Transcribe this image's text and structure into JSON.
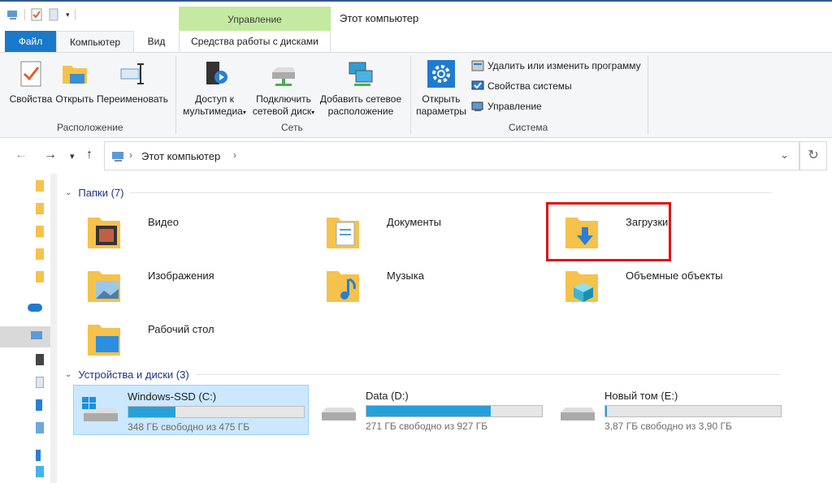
{
  "window": {
    "title": "Этот компьютер",
    "context_tab": "Управление"
  },
  "tabs": {
    "file": "Файл",
    "computer": "Компьютер",
    "view": "Вид",
    "disk_tools": "Средства работы с дисками"
  },
  "ribbon": {
    "location": {
      "label": "Расположение",
      "properties": "Свойства",
      "open": "Открыть",
      "rename": "Переименовать"
    },
    "network": {
      "label": "Сеть",
      "media_1": "Доступ к",
      "media_2": "мультимедиа",
      "map_1": "Подключить",
      "map_2": "сетевой диск",
      "add_1": "Добавить сетевое",
      "add_2": "расположение"
    },
    "system": {
      "label": "Система",
      "settings_1": "Открыть",
      "settings_2": "параметры",
      "uninstall": "Удалить или изменить программу",
      "sysprops": "Свойства системы",
      "manage": "Управление"
    }
  },
  "address": {
    "path": "Этот компьютер"
  },
  "folders": {
    "header": "Папки (7)",
    "items": [
      {
        "label": "Видео"
      },
      {
        "label": "Документы"
      },
      {
        "label": "Загрузки"
      },
      {
        "label": "Изображения"
      },
      {
        "label": "Музыка"
      },
      {
        "label": "Объемные объекты"
      },
      {
        "label": "Рабочий стол"
      }
    ]
  },
  "drives": {
    "header": "Устройства и диски (3)",
    "items": [
      {
        "name": "Windows-SSD (C:)",
        "free": "348 ГБ свободно из 475 ГБ",
        "used_fraction": 0.267
      },
      {
        "name": "Data (D:)",
        "free": "271 ГБ свободно из 927 ГБ",
        "used_fraction": 0.708
      },
      {
        "name": "Новый том (E:)",
        "free": "3,87 ГБ свободно из 3,90 ГБ",
        "used_fraction": 0.008
      }
    ]
  },
  "colors": {
    "accent": "#1979ca",
    "context_tab": "#c3eaa0",
    "drive_bar": "#26a0da",
    "highlight_box": "#e01111"
  }
}
